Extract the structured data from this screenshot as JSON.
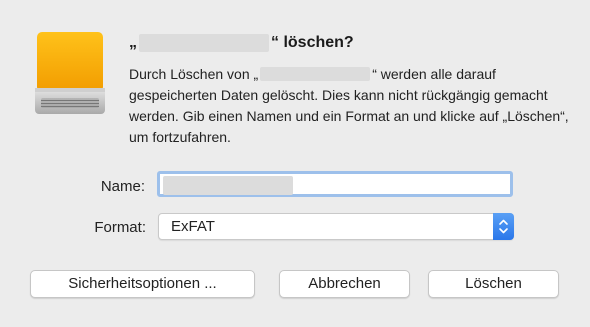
{
  "dialog": {
    "title_open_quote": "„",
    "title_suffix": "“ löschen?",
    "desc_prefix": "Durch Löschen von „",
    "desc_suffix": "“ werden alle darauf gespeicherten Daten gelöscht. Dies kann nicht rückgängig gemacht werden. Gib einen Namen und ein Format an und klicke auf „Löschen“, um fortzufahren."
  },
  "form": {
    "name_label": "Name:",
    "format_label": "Format:",
    "format_value": "ExFAT"
  },
  "buttons": {
    "security_label": "Sicherheitsoptionen ...",
    "cancel_label": "Abbrechen",
    "erase_label": "Löschen"
  },
  "colors": {
    "drive_orange": "#f6a500",
    "stepper_blue": "#2a77ea",
    "focus_ring": "#9dc0eb"
  },
  "icons": {
    "drive": "external-drive-icon",
    "stepper": "up-down-chevron-icon"
  }
}
